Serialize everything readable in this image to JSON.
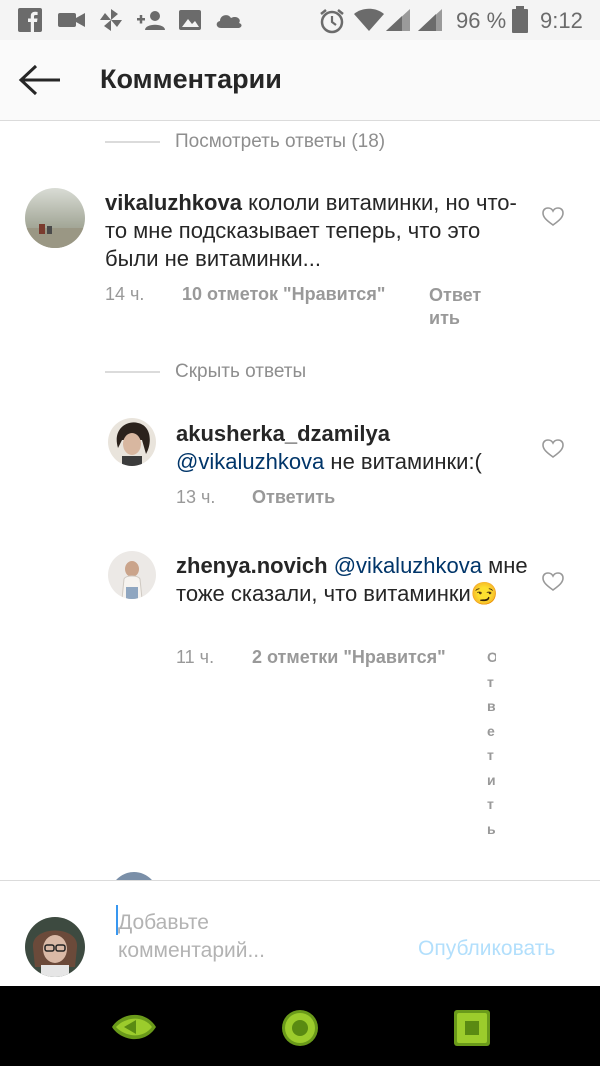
{
  "status": {
    "battery": "96 %",
    "time": "9:12"
  },
  "header": {
    "title": "Комментарии"
  },
  "thread": {
    "view_replies": "Посмотреть ответы (18)",
    "hide_replies": "Скрыть ответы"
  },
  "comments": [
    {
      "username": "vikaluzhkova",
      "text": "кололи витаминки, но что-то мне подсказывает теперь, что это были не витаминки...",
      "time": "14 ч.",
      "likes": "10 отметок \"Нравится\"",
      "reply": "Ответ ить"
    }
  ],
  "replies": [
    {
      "username": "akusherka_dzamilya",
      "mention": "@vikaluzhkova",
      "text": "не витаминки:(",
      "time": "13 ч.",
      "reply": "Ответить"
    },
    {
      "username": "zhenya.novich",
      "mention": "@vikaluzhkova",
      "text": "мне тоже сказали, что витаминки",
      "emoji": "😏",
      "time": "11 ч.",
      "likes": "2 отметки \"Нравится\"",
      "reply_vertical": "Ответить"
    }
  ],
  "composer": {
    "placeholder": "Добавьте комментарий...",
    "publish": "Опубликовать"
  },
  "colors": {
    "link": "#003569",
    "publish": "#b2dffc",
    "muted": "#999999"
  }
}
